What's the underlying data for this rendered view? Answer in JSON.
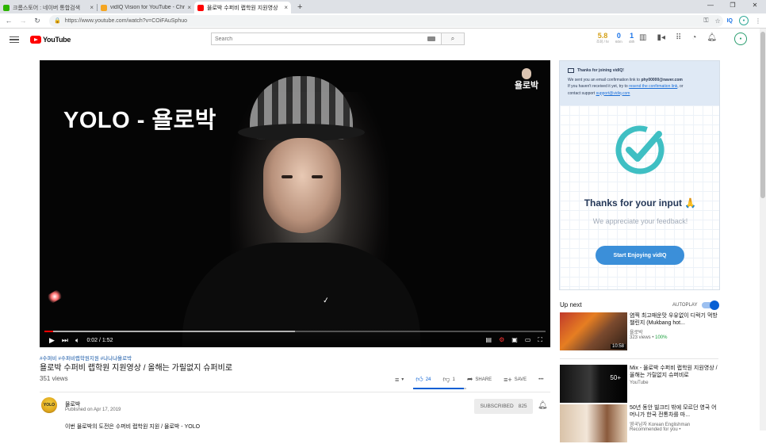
{
  "browser": {
    "tabs": [
      {
        "title": "크롬스토어 : 네이버 통합검색",
        "color": "#2db400"
      },
      {
        "title": "vidIQ Vision for YouTube - Chr",
        "color": "#f5a623"
      },
      {
        "title": "욜로박 수퍼비 랩학원 지원영상",
        "color": "#ff0000"
      }
    ],
    "close": "×",
    "new_tab": "+",
    "url": "https://www.youtube.com/watch?v=COiFAuSphuo"
  },
  "youtube": {
    "logo_text": "YouTube",
    "search_placeholder": "Search",
    "vidiq_stats": [
      {
        "value": "5.8",
        "label": "조회 / hr",
        "color": "#d4a017"
      },
      {
        "value": "0",
        "label": "60m",
        "color": "#1a73e8"
      },
      {
        "value": "1",
        "label": "48h",
        "color": "#1a73e8"
      }
    ]
  },
  "video": {
    "overlay_text": "YOLO - 욜로박",
    "watermark": "욜로박",
    "time": "0:02 / 1:52",
    "progress": 0.018,
    "buffered": 0.5,
    "tags": "#수퍼비 #수퍼비랩학원지원 #냐냐냐욜로박",
    "title": "욜로박 수퍼비 랩학원 지원영상 / 올해는 가릴없지 슈퍼비로",
    "views": "351 views",
    "likes": "24",
    "dislikes": "1",
    "like_ratio": 0.96,
    "share": "SHARE",
    "save": "SAVE",
    "channel": "욜로박",
    "published": "Published on Apr 17, 2019",
    "subscribed_label": "SUBSCRIBED",
    "subscriber_count": "825",
    "description": "이번 욜로박의 도전은 수퍼비 랩학원 지원 / 욜로박 - YOLO"
  },
  "vidiq": {
    "notice_title": "Thanks for joining vidIQ!",
    "notice_line1_pre": "We sent you an email confirmation link to",
    "email": "phy00000@naver.com",
    "notice_line2_pre": "If you haven't received it yet, try to",
    "resend_link": "resend the confirmation link",
    "notice_line2_post": ", or",
    "notice_line3_pre": "contact support",
    "support_email": "support@vidiq.com",
    "thanks": "Thanks for your input 🙏",
    "appreciate": "We appreciate your feedback!",
    "button": "Start Enjoying vidIQ",
    "accent": "#3fbfc3"
  },
  "sidebar": {
    "up_next": "Up next",
    "autoplay": "AUTOPLAY",
    "recs": [
      {
        "title": "염찍 최고매운맛 우유없이 디럭기 먹방 챌린지 (Mukbang hot...",
        "channel": "욜로박",
        "meta": "323 views • ",
        "meta_hi": "100%",
        "duration": "10:58"
      },
      {
        "title": "Mix - 욜로박 수퍼비 랩학원 지원영상 / 올해는 가릴없지 슈퍼비로",
        "channel": "YouTube",
        "meta": "",
        "meta_hi": "",
        "duration": "50+"
      },
      {
        "title": "50년 동안 빌크티 밖에 모르던 영국 어머니가 한국 전통차를 마...",
        "channel": "영국남자 Korean Englishman",
        "meta": "Recommended for you • ",
        "meta_hi": "",
        "duration": ""
      }
    ]
  }
}
